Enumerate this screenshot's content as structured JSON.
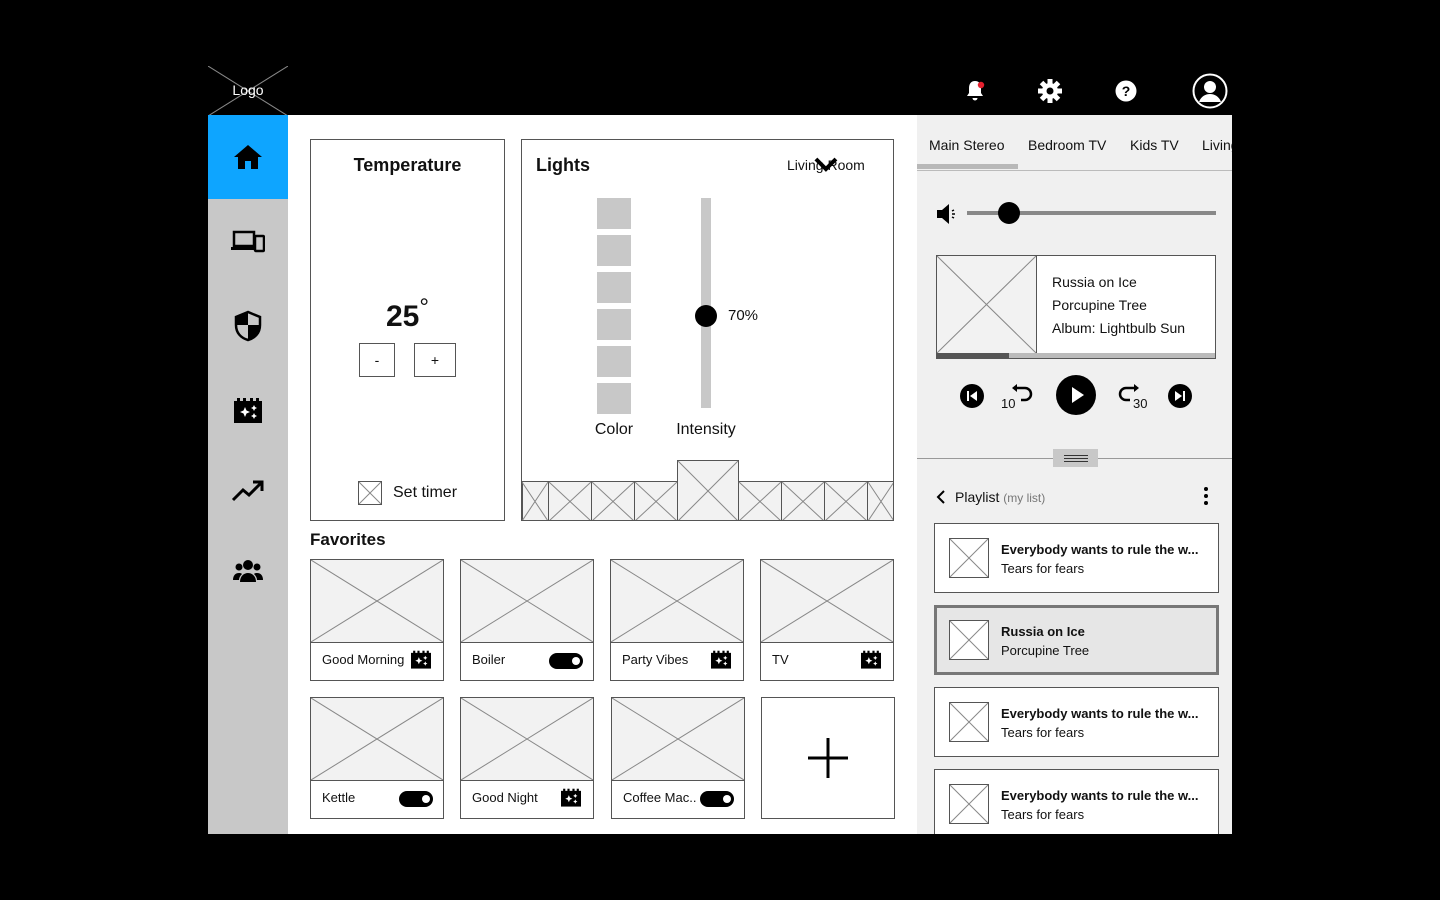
{
  "header": {
    "logo_label": "Logo",
    "icons": [
      "bell-icon",
      "gear-icon",
      "help-icon",
      "user-icon"
    ],
    "notification_dot_color": "#e5202e"
  },
  "sidebar": {
    "active_color": "#0ea5ff",
    "items": [
      {
        "icon": "home-icon"
      },
      {
        "icon": "devices-icon"
      },
      {
        "icon": "shield-icon"
      },
      {
        "icon": "scenes-icon"
      },
      {
        "icon": "trending-icon"
      },
      {
        "icon": "people-icon"
      }
    ]
  },
  "temperature": {
    "title": "Temperature",
    "value": "25",
    "unit": "°",
    "minus_label": "-",
    "plus_label": "+",
    "timer_label": "Set timer"
  },
  "lights": {
    "title": "Lights",
    "room": "Living Room",
    "color_label": "Color",
    "intensity_label": "Intensity",
    "intensity_value": "70%",
    "intensity_fraction": 0.56
  },
  "favorites": {
    "title": "Favorites",
    "items": [
      {
        "label": "Good Morning",
        "control": "scene"
      },
      {
        "label": "Boiler",
        "control": "toggle"
      },
      {
        "label": "Party Vibes",
        "control": "scene"
      },
      {
        "label": "TV",
        "control": "scene"
      },
      {
        "label": "Kettle",
        "control": "toggle"
      },
      {
        "label": "Good Night",
        "control": "scene"
      },
      {
        "label": "Coffee Mac..",
        "control": "toggle"
      }
    ],
    "add_label": "+"
  },
  "player": {
    "tabs": [
      "Main Stereo",
      "Bedroom TV",
      "Kids TV",
      "Living"
    ],
    "active_tab": 0,
    "volume_fraction": 0.17,
    "now_playing": {
      "track": "Russia on Ice",
      "artist": "Porcupine Tree",
      "album": "Album: Lightbulb Sun"
    },
    "progress_fraction": 0.26,
    "rewind_label": "10",
    "forward_label": "30"
  },
  "playlist": {
    "title": "Playlist",
    "subtitle": "(my list)",
    "items": [
      {
        "title": "Everybody wants to rule the w...",
        "artist": "Tears for fears",
        "selected": false
      },
      {
        "title": "Russia on Ice",
        "artist": "Porcupine Tree",
        "selected": true
      },
      {
        "title": "Everybody wants to rule the w...",
        "artist": "Tears for fears",
        "selected": false
      },
      {
        "title": "Everybody wants to rule the w...",
        "artist": "Tears for fears",
        "selected": false
      }
    ]
  }
}
